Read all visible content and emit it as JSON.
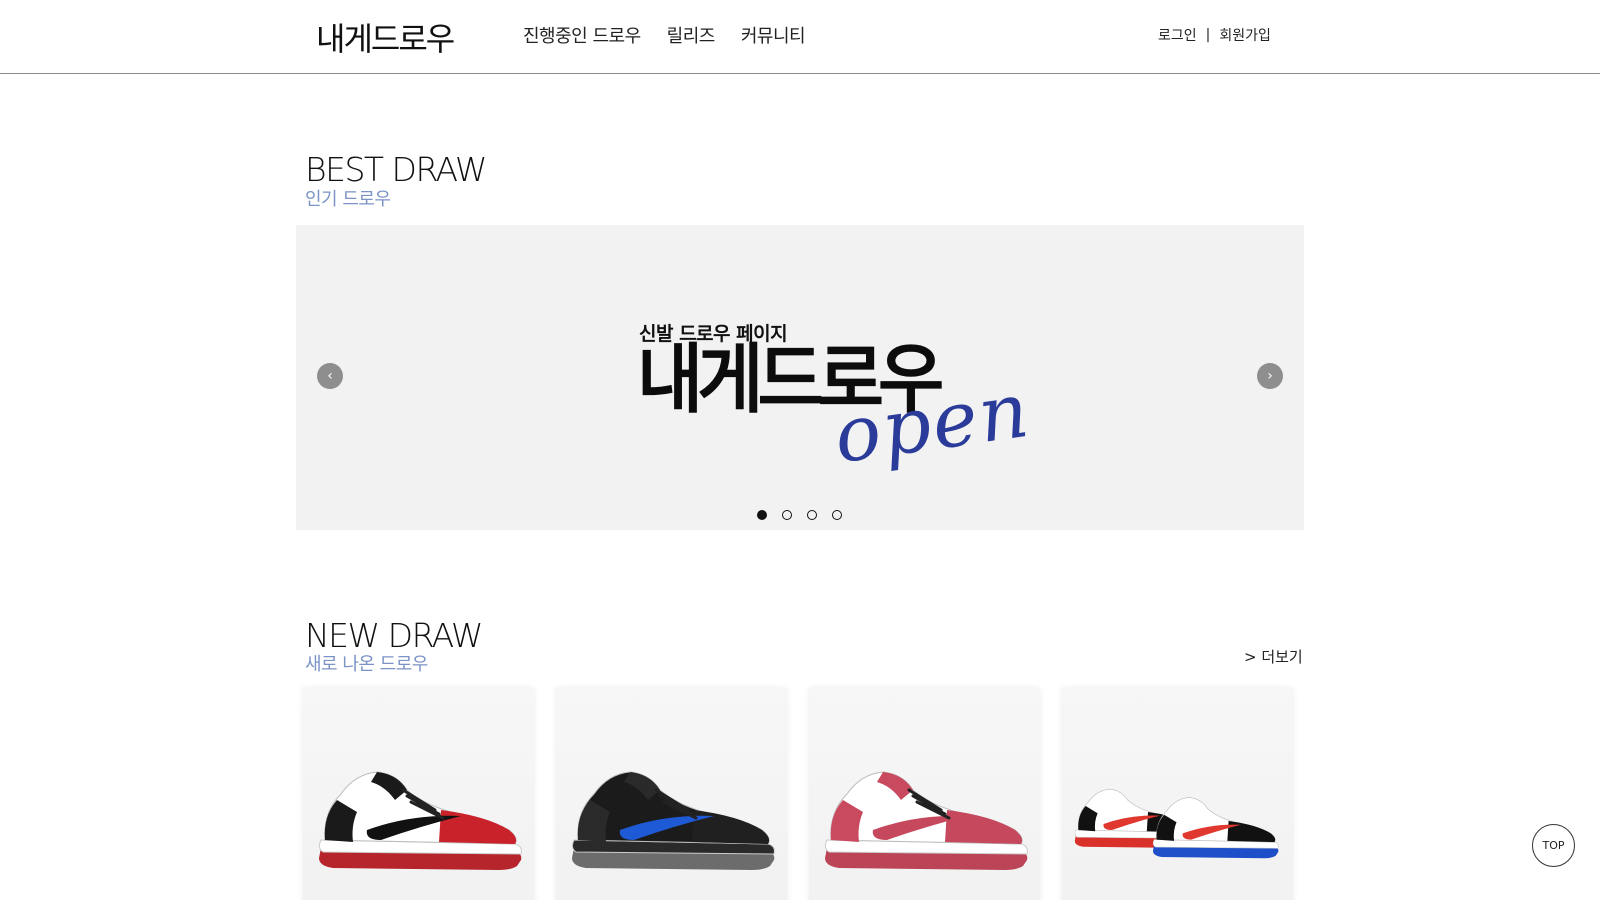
{
  "header": {
    "logo": "내게드로우",
    "nav": [
      {
        "label": "진행중인 드로우"
      },
      {
        "label": "릴리즈"
      },
      {
        "label": "커뮤니티"
      }
    ],
    "login": "로그인",
    "separator": "|",
    "signup": "회원가입"
  },
  "best": {
    "title": "BEST DRAW",
    "subtitle": "인기 드로우"
  },
  "banner": {
    "prev_icon": "‹",
    "next_icon": "›",
    "subtitle": "신발 드로우 페이지",
    "title": "내게드로우",
    "script": "open",
    "slide_count": 4,
    "active_slide": 1
  },
  "new": {
    "title": "NEW DRAW",
    "subtitle": "새로 나온 드로우",
    "more": "> 더보기"
  },
  "products": [
    {
      "icon": "sneaker-red-black-icon",
      "colors": {
        "upper": "#ffffff",
        "toe": "#c9222a",
        "overlay": "#1a1a1a",
        "swoosh": "#111111",
        "sole": "#ffffff",
        "outsole": "#b5252b"
      }
    },
    {
      "icon": "sneaker-black-blue-icon",
      "colors": {
        "upper": "#1b1b1b",
        "toe": "#202020",
        "overlay": "#2a2a2a",
        "swoosh": "#1e5ad6",
        "sole": "#2a2a2a",
        "outsole": "#6c6c6c"
      }
    },
    {
      "icon": "sneaker-pink-white-icon",
      "colors": {
        "upper": "#ffffff",
        "toe": "#c5485d",
        "overlay": "#c94a5e",
        "swoosh": "#c5485d",
        "sole": "#ffffff",
        "outsole": "#bb4456"
      }
    },
    {
      "icon": "sneaker-pair-tricolor-icon",
      "colors": {
        "upper": "#ffffff",
        "toe": "#111111",
        "overlay": "#111111",
        "swoosh": "#e0372e",
        "sole": "#ffffff",
        "outsole": "#1e4fc8"
      }
    }
  ],
  "top_button": "TOP"
}
